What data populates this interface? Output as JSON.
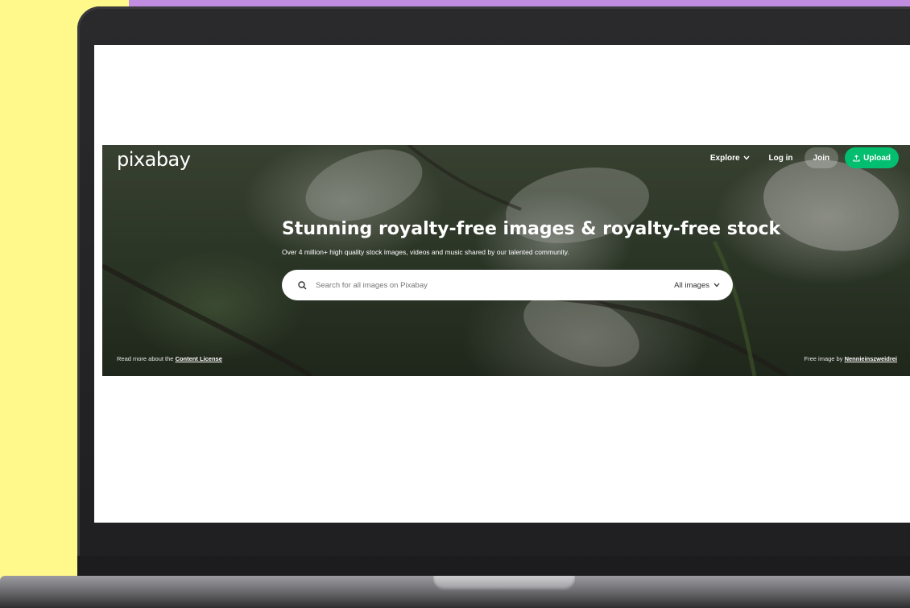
{
  "site": {
    "logo": "pixabay",
    "nav": {
      "explore": "Explore",
      "login": "Log in",
      "join": "Join",
      "upload": "Upload"
    }
  },
  "hero": {
    "headline": "Stunning royalty-free images & royalty-free stock",
    "subline": "Over 4 million+ high quality stock images, videos and music shared by our talented community.",
    "search": {
      "placeholder": "Search for all images on Pixabay",
      "filter": "All images"
    },
    "footer": {
      "license_prefix": "Read more about the",
      "license_link": "Content License",
      "credit_prefix": "Free image by",
      "credit_link": "Nennieinszweidrei"
    }
  },
  "colors": {
    "background": "#fef98a",
    "purple_bar": "#c18de0",
    "upload_button": "#02be6e"
  }
}
